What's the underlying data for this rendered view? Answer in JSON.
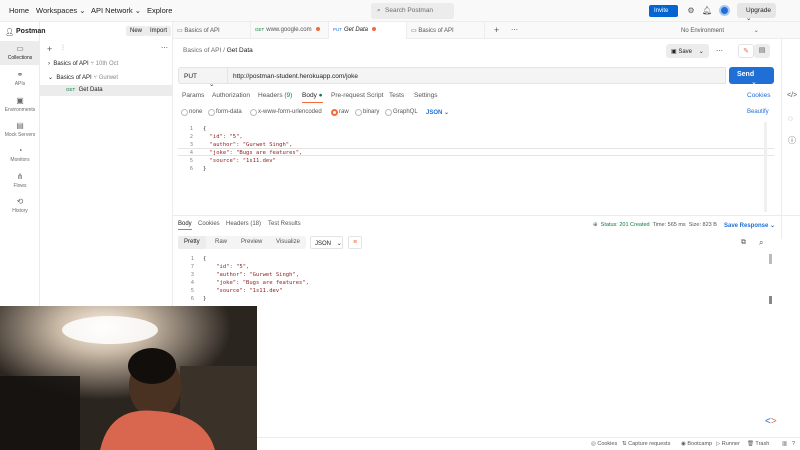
{
  "topbar": {
    "nav": [
      "Home",
      "Workspaces",
      "API Network",
      "Explore"
    ],
    "search_placeholder": "Search Postman",
    "invite_label": "Invite",
    "upgrade_label": "Upgrade"
  },
  "sidebar": {
    "items": [
      "Collections",
      "APIs",
      "Environments",
      "Mock Servers",
      "Monitors",
      "Flows",
      "History"
    ]
  },
  "collections": {
    "workspace": "Postman",
    "new_label": "New",
    "import_label": "Import",
    "tree": [
      {
        "name": "Basics of API",
        "meta": "10th Oct"
      },
      {
        "name": "Basics of API",
        "meta": "Gurwet"
      }
    ],
    "request": {
      "method": "GET",
      "name": "Get Data"
    }
  },
  "tabs": [
    {
      "method": "",
      "label": "Basics of API"
    },
    {
      "method": "GET",
      "label": "www.google.com"
    },
    {
      "method": "PUT",
      "label": "Get Data"
    },
    {
      "method": "",
      "label": "Basics of API"
    }
  ],
  "env_label": "No Environment",
  "breadcrumb": {
    "parent": "Basics of API",
    "sep": "/",
    "current": "Get Data"
  },
  "save_label": "Save",
  "request": {
    "method": "PUT",
    "url": "http://postman-student.herokuapp.com/joke",
    "send_label": "Send",
    "tabs": [
      "Params",
      "Authorization",
      "Headers",
      "Body",
      "Pre-request Script",
      "Tests",
      "Settings"
    ],
    "headers_count": "(9)",
    "cookies_label": "Cookies",
    "body_types": [
      "none",
      "form-data",
      "x-www-form-urlencoded",
      "raw",
      "binary",
      "GraphQL"
    ],
    "format": "JSON",
    "beautify_label": "Beautify",
    "body_lines": [
      {
        "n": "1",
        "t": "{"
      },
      {
        "n": "2",
        "t": "  \"id\": \"5\","
      },
      {
        "n": "3",
        "t": "  \"author\": \"Gurwet Singh\","
      },
      {
        "n": "4",
        "t": "  \"joke\": \"Bugs are features\","
      },
      {
        "n": "5",
        "t": "  \"source\": \"1s11.dev\""
      },
      {
        "n": "6",
        "t": "}"
      }
    ]
  },
  "response": {
    "tabs": [
      "Body",
      "Cookies",
      "Headers (18)",
      "Test Results"
    ],
    "status": "Status: 201 Created",
    "time": "Time: 565 ms",
    "size": "Size: 823 B",
    "save_label": "Save Response",
    "formats": [
      "Pretty",
      "Raw",
      "Preview",
      "Visualize"
    ],
    "format": "JSON",
    "body_lines": [
      {
        "n": "1",
        "t": "{"
      },
      {
        "n": "7",
        "t": "    \"id\": \"5\","
      },
      {
        "n": "3",
        "t": "    \"author\": \"Gurwet Singh\","
      },
      {
        "n": "4",
        "t": "    \"joke\": \"Bugs are features\","
      },
      {
        "n": "5",
        "t": "    \"source\": \"1s11.dev\""
      },
      {
        "n": "6",
        "t": "}"
      }
    ]
  },
  "statusbar": [
    "Cookies",
    "Capture requests",
    "Bootcamp",
    "Runner",
    "Trash"
  ],
  "colors": {
    "accent": "#f26b3a",
    "primary": "#1f6fd6",
    "success": "#0a7d3e"
  }
}
